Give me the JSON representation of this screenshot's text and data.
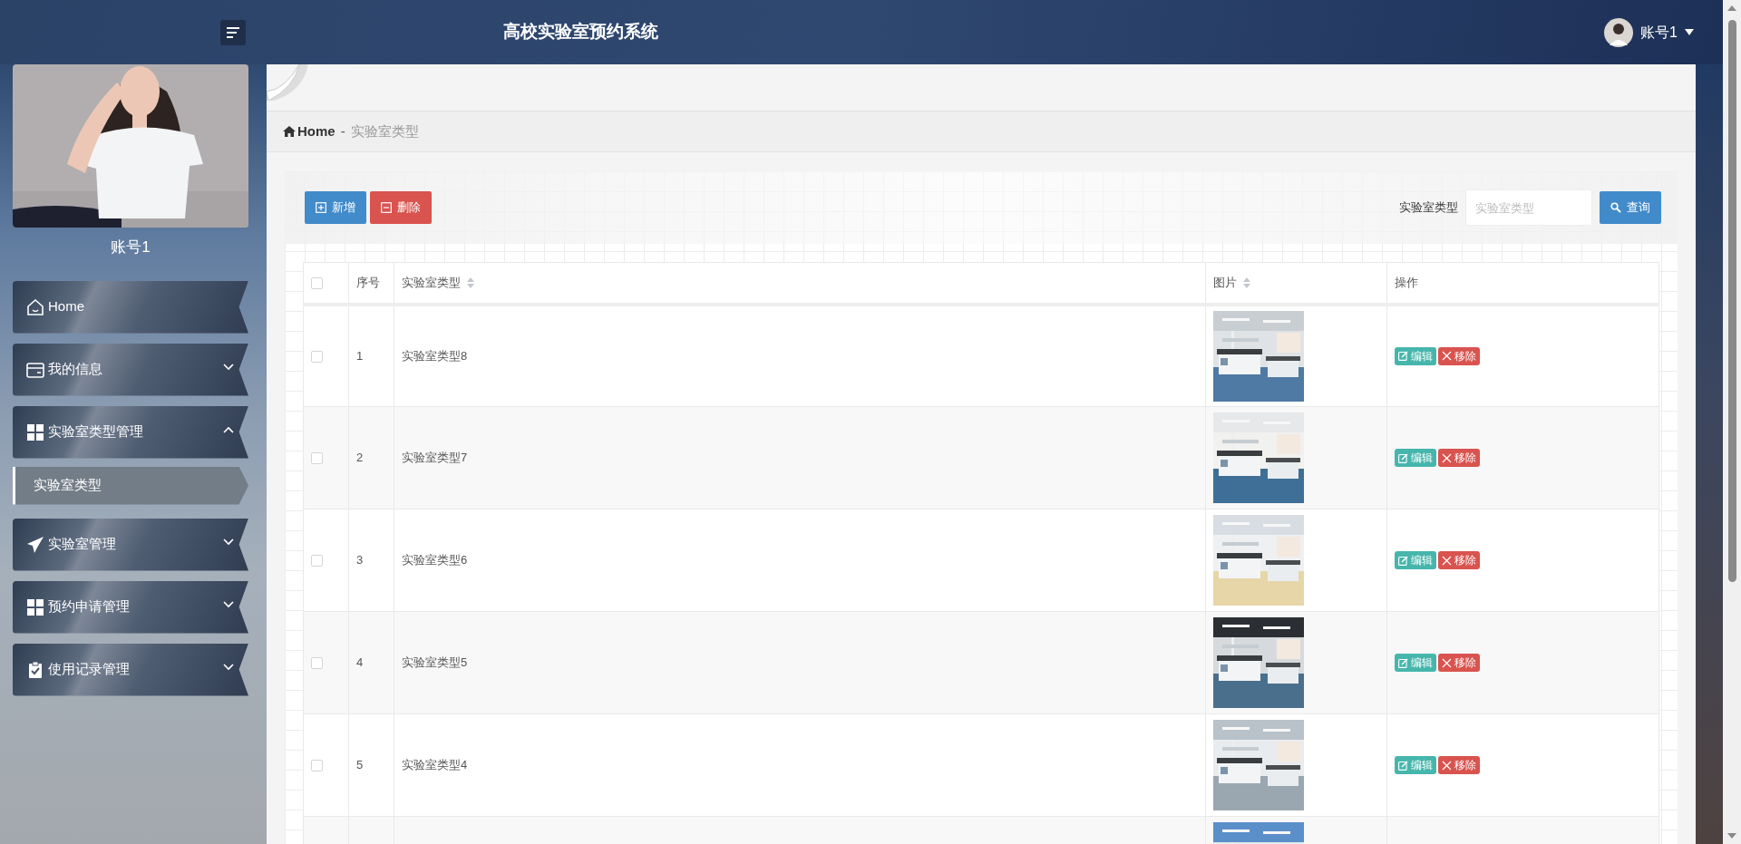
{
  "header": {
    "title": "高校实验室预约系统",
    "user": {
      "name": "账号1"
    }
  },
  "sidebar": {
    "profile": {
      "name": "账号1"
    },
    "items": [
      {
        "label": "Home",
        "kind": "link"
      },
      {
        "label": "我的信息",
        "kind": "group",
        "expanded": false
      },
      {
        "label": "实验室类型管理",
        "kind": "group",
        "expanded": true,
        "children": [
          {
            "label": "实验室类型",
            "selected": true
          }
        ]
      },
      {
        "label": "实验室管理",
        "kind": "group",
        "expanded": false
      },
      {
        "label": "预约申请管理",
        "kind": "group",
        "expanded": false
      },
      {
        "label": "使用记录管理",
        "kind": "group",
        "expanded": false
      }
    ]
  },
  "breadcrumb": {
    "home": "Home",
    "separator": "-",
    "current": "实验室类型"
  },
  "toolbar": {
    "buttons": [
      {
        "label": "新增",
        "kind": "add"
      },
      {
        "label": "删除",
        "kind": "delete"
      }
    ],
    "search": {
      "label": "实验室类型",
      "placeholder": "实验室类型",
      "button": "查询"
    }
  },
  "table": {
    "header_checkbox": {
      "checked": false
    },
    "columns": [
      {
        "label": "序号",
        "sortable": false
      },
      {
        "label": "实验室类型",
        "sortable": true
      },
      {
        "label": "图片",
        "sortable": true
      },
      {
        "label": "操作",
        "sortable": false
      }
    ],
    "rows": [
      {
        "checked": false,
        "index": "1",
        "name": "实验室类型8",
        "actions": [
          {
            "label": "编辑",
            "kind": "edit"
          },
          {
            "label": "移除",
            "kind": "remove"
          }
        ]
      },
      {
        "checked": false,
        "index": "2",
        "name": "实验室类型7",
        "actions": [
          {
            "label": "编辑",
            "kind": "edit"
          },
          {
            "label": "移除",
            "kind": "remove"
          }
        ]
      },
      {
        "checked": false,
        "index": "3",
        "name": "实验室类型6",
        "actions": [
          {
            "label": "编辑",
            "kind": "edit"
          },
          {
            "label": "移除",
            "kind": "remove"
          }
        ]
      },
      {
        "checked": false,
        "index": "4",
        "name": "实验室类型5",
        "actions": [
          {
            "label": "编辑",
            "kind": "edit"
          },
          {
            "label": "移除",
            "kind": "remove"
          }
        ]
      },
      {
        "checked": false,
        "index": "5",
        "name": "实验室类型4",
        "actions": [
          {
            "label": "编辑",
            "kind": "edit"
          },
          {
            "label": "移除",
            "kind": "remove"
          }
        ]
      }
    ]
  }
}
